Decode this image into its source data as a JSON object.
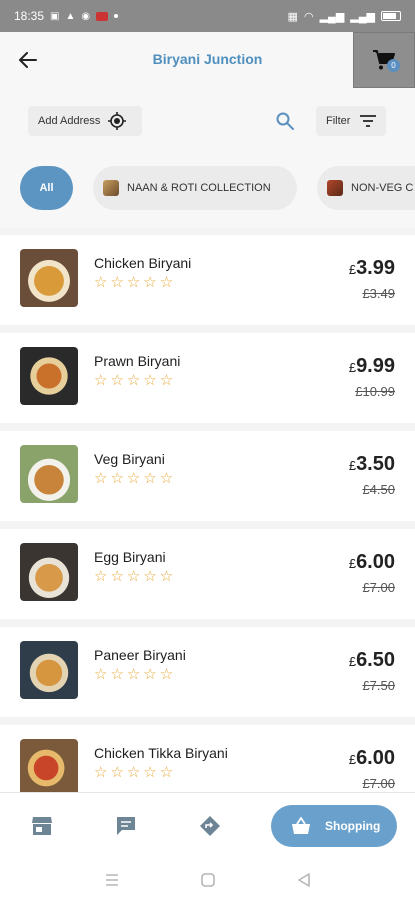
{
  "status_bar": {
    "time": "18:35"
  },
  "header": {
    "title": "Biryani Junction",
    "cart_count": "0"
  },
  "toolbar": {
    "address_label": "Add Address",
    "filter_label": "Filter"
  },
  "categories": [
    {
      "label": "All",
      "selected": true
    },
    {
      "label": "NAAN & ROTI COLLECTION"
    },
    {
      "label": "NON-VEG C"
    }
  ],
  "products": [
    {
      "name": "Chicken Biryani",
      "currency": "£",
      "price": "3.99",
      "old_price": "£3.49",
      "rating": 0
    },
    {
      "name": "Prawn Biryani",
      "currency": "£",
      "price": "9.99",
      "old_price": "£10.99",
      "rating": 0
    },
    {
      "name": "Veg Biryani",
      "currency": "£",
      "price": "3.50",
      "old_price": "£4.50",
      "rating": 0
    },
    {
      "name": "Egg Biryani",
      "currency": "£",
      "price": "6.00",
      "old_price": "£7.00",
      "rating": 0
    },
    {
      "name": "Paneer Biryani",
      "currency": "£",
      "price": "6.50",
      "old_price": "£7.50",
      "rating": 0
    },
    {
      "name": "Chicken Tikka Biryani",
      "currency": "£",
      "price": "6.00",
      "old_price": "£7.00",
      "rating": 0
    }
  ],
  "stars_text": "☆☆☆☆☆",
  "bottom_nav": {
    "shopping_label": "Shopping"
  },
  "colors": {
    "accent": "#4f8fbe",
    "chip_selected": "#5d95c2",
    "star": "#e8a93a"
  }
}
